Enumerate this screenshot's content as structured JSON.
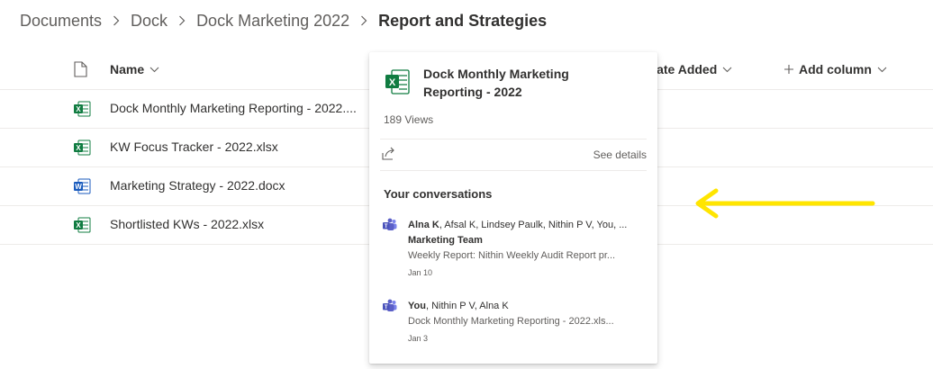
{
  "breadcrumb": {
    "items": [
      "Documents",
      "Dock",
      "Dock Marketing 2022"
    ],
    "current": "Report and Strategies"
  },
  "columns": {
    "name": "Name",
    "date_added": "Date Added",
    "add_column": "Add column"
  },
  "files": [
    {
      "name": "Dock Monthly Marketing Reporting - 2022....",
      "type": "excel"
    },
    {
      "name": "KW Focus Tracker - 2022.xlsx",
      "type": "excel"
    },
    {
      "name": "Marketing Strategy - 2022.docx",
      "type": "word"
    },
    {
      "name": "Shortlisted KWs - 2022.xlsx",
      "type": "excel"
    }
  ],
  "hovercard": {
    "title": "Dock Monthly Marketing Reporting - 2022",
    "views": "189 Views",
    "see_details": "See details",
    "conversations_title": "Your conversations",
    "conversations": [
      {
        "participants_bold": "Alna K",
        "participants_rest": ", Afsal K, Lindsey Paulk, Nithin P V, You, ...",
        "group": "Marketing Team",
        "preview": "Weekly Report: Nithin Weekly Audit Report pr...",
        "date": "Jan 10"
      },
      {
        "participants_bold": "You",
        "participants_rest": ", Nithin P V, Alna K",
        "group": "",
        "preview": "Dock Monthly Marketing Reporting - 2022.xls...",
        "date": "Jan 3"
      }
    ]
  },
  "colors": {
    "excel": "#107c41",
    "word": "#185abd",
    "teams": "#5b5fc7",
    "arrow": "#ffe500"
  },
  "icons": [
    "file-icon",
    "excel-icon",
    "word-icon",
    "share-icon",
    "teams-icon",
    "chevron-down-icon",
    "plus-icon",
    "arrow-icon"
  ]
}
